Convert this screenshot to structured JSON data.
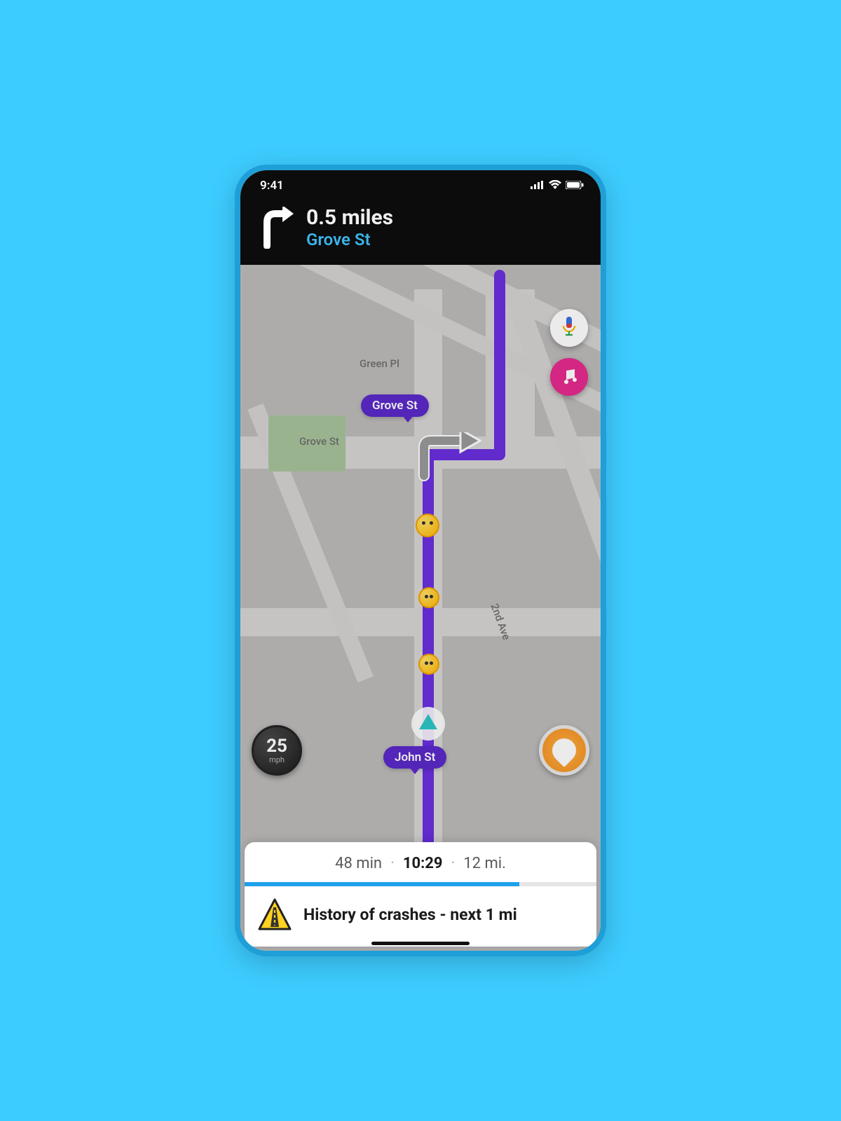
{
  "status": {
    "time": "9:41"
  },
  "nav": {
    "distance": "0.5 miles",
    "street": "Grove St"
  },
  "map": {
    "labels": {
      "green_pl": "Green Pl",
      "grove_st": "Grove St",
      "second_ave": "2nd Ave",
      "john_st": "John St"
    },
    "route_bubble_upper": "Grove St"
  },
  "speed": {
    "value": "25",
    "unit": "mph"
  },
  "eta": {
    "duration": "48 min",
    "arrival": "10:29",
    "distance": "12 mi.",
    "progress_pct": 78
  },
  "alert": {
    "text": "History of crashes - next 1 mi"
  },
  "colors": {
    "route": "#6a2fe0",
    "accent_blue": "#1ea0ea",
    "music_pink": "#e52b8f"
  }
}
